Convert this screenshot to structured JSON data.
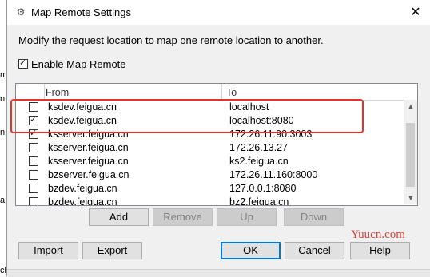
{
  "window": {
    "title": "Map Remote Settings",
    "close_glyph": "✕",
    "icon": "settings-app-icon",
    "icon_glyph": "⚙"
  },
  "description": "Modify the request location to map one remote location to another.",
  "enable": {
    "label": "Enable Map Remote",
    "checked": true
  },
  "table": {
    "headers": {
      "from": "From",
      "to": "To"
    },
    "rows": [
      {
        "checked": false,
        "from": "ksdev.feigua.cn",
        "to": "localhost"
      },
      {
        "checked": true,
        "from": "ksdev.feigua.cn",
        "to": "localhost:8080"
      },
      {
        "checked": true,
        "from": "ksserver.feigua.cn",
        "to": "172.26.11.90:3003"
      },
      {
        "checked": false,
        "from": "ksserver.feigua.cn",
        "to": "172.26.13.27"
      },
      {
        "checked": false,
        "from": "ksserver.feigua.cn",
        "to": "ks2.feigua.cn"
      },
      {
        "checked": false,
        "from": "bzserver.feigua.cn",
        "to": "172.26.11.160:8000"
      },
      {
        "checked": false,
        "from": "bzdev.feigua.cn",
        "to": "127.0.0.1:8080"
      },
      {
        "checked": false,
        "from": "bzdev.feigua.cn",
        "to": "bz2.feigua.cn"
      }
    ]
  },
  "buttons": {
    "add": "Add",
    "remove": "Remove",
    "up": "Up",
    "down": "Down",
    "import": "Import",
    "export": "Export",
    "ok": "OK",
    "cancel": "Cancel",
    "help": "Help"
  },
  "watermark": "Yuucn.com",
  "background": {
    "bottom_text": "click.net"
  },
  "colors": {
    "highlight": "#e8312a",
    "default_button": "#0078d7"
  }
}
